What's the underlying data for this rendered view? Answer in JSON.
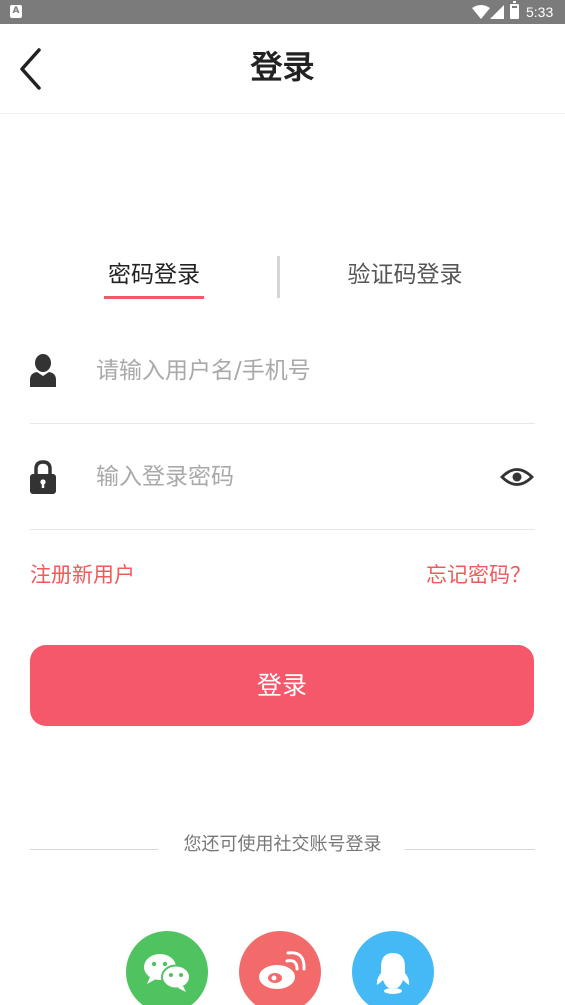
{
  "statusbar": {
    "notification_letter": "A",
    "time": "5:33"
  },
  "header": {
    "title": "登录"
  },
  "tabs": [
    {
      "label": "密码登录",
      "active": true
    },
    {
      "label": "验证码登录",
      "active": false
    }
  ],
  "fields": {
    "username": {
      "placeholder": "请输入用户名/手机号",
      "value": ""
    },
    "password": {
      "placeholder": "输入登录密码",
      "value": ""
    }
  },
  "links": {
    "register": "注册新用户",
    "forgot": "忘记密码？"
  },
  "login_button": {
    "label": "登录"
  },
  "social": {
    "divider_text": "您还可使用社交账号登录",
    "buttons": [
      {
        "icon": "wechat-icon",
        "color": "#4ec35f"
      },
      {
        "icon": "weibo-icon",
        "color": "#f26a6a"
      },
      {
        "icon": "qq-icon",
        "color": "#45b9f5"
      }
    ]
  },
  "colors": {
    "accent": "#f5576b",
    "link": "#f05a5a",
    "statusbar": "#7b7b7b"
  }
}
